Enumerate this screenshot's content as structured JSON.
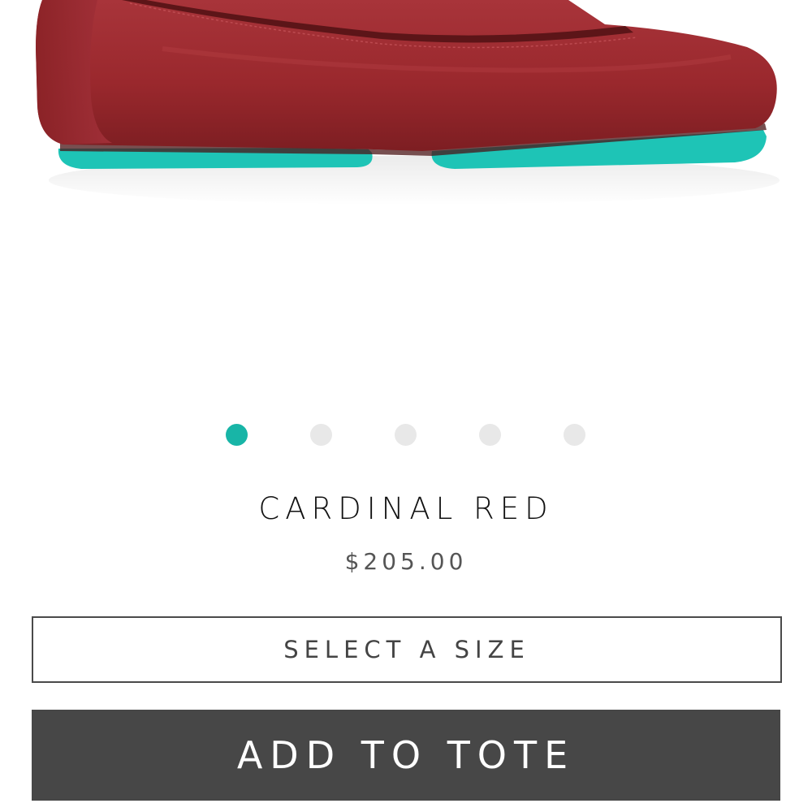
{
  "colors": {
    "accent": "#18b5a7",
    "button_bg": "#474747",
    "shoe_leather": "#9c2a2e",
    "shoe_sole": "#1ec4b6"
  },
  "product": {
    "image_icon": "ballet-flat-shoe",
    "name": "CARDINAL RED",
    "price": "$205.00"
  },
  "carousel": {
    "count": 5,
    "active_index": 0
  },
  "size_select": {
    "label": "SELECT A SIZE"
  },
  "cta": {
    "label": "ADD TO TOTE"
  }
}
